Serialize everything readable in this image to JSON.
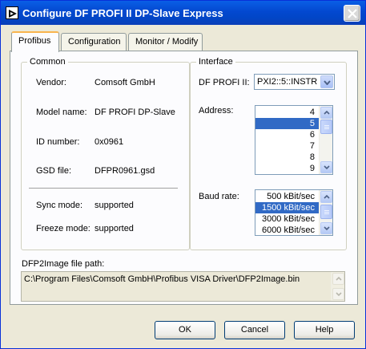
{
  "window": {
    "title": "Configure DF PROFI II DP-Slave Express"
  },
  "tabs": [
    {
      "label": "Profibus"
    },
    {
      "label": "Configuration"
    },
    {
      "label": "Monitor / Modify"
    }
  ],
  "common": {
    "group_label": "Common",
    "vendor_label": "Vendor:",
    "vendor_value": "Comsoft GmbH",
    "model_label": "Model name:",
    "model_value": "DF PROFI DP-Slave",
    "id_label": "ID number:",
    "id_value": "0x0961",
    "gsd_label": "GSD file:",
    "gsd_value": "DFPR0961.gsd",
    "sync_label": "Sync mode:",
    "sync_value": "supported",
    "freeze_label": "Freeze mode:",
    "freeze_value": "supported"
  },
  "interface": {
    "group_label": "Interface",
    "dfprofi_label": "DF PROFI II:",
    "dfprofi_value": "PXI2::5::INSTR",
    "address_label": "Address:",
    "address_items": [
      "4",
      "5",
      "6",
      "7",
      "8",
      "9"
    ],
    "address_selected": "5",
    "baud_label": "Baud rate:",
    "baud_items": [
      "500 kBit/sec",
      "1500 kBit/sec",
      "3000 kBit/sec",
      "6000 kBit/sec"
    ],
    "baud_selected": "1500 kBit/sec"
  },
  "image_path": {
    "label": "DFP2Image file path:",
    "value": "C:\\Program Files\\Comsoft GmbH\\Profibus VISA Driver\\DFP2Image.bin"
  },
  "buttons": {
    "ok": "OK",
    "cancel": "Cancel",
    "help": "Help"
  },
  "colors": {
    "titlebar": "#0348d0",
    "selection": "#316ac5",
    "dialog": "#ece9d8"
  }
}
